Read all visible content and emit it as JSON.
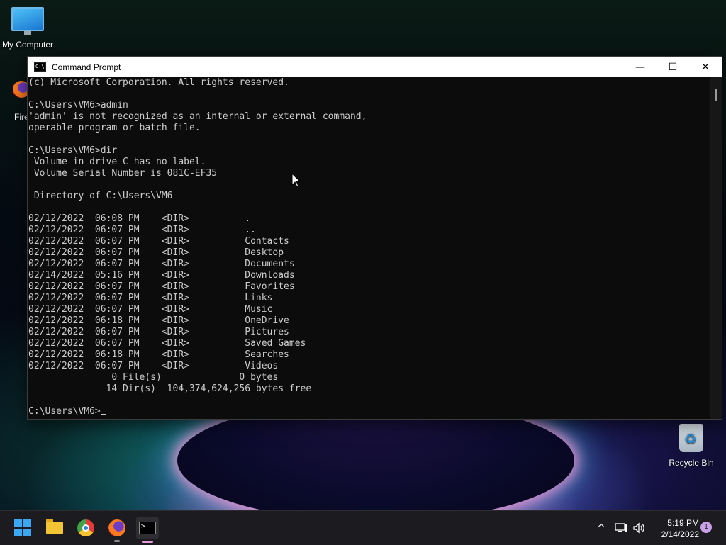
{
  "desktop": {
    "icons": [
      {
        "label": "My Computer",
        "icon": "computer-icon"
      },
      {
        "label": "Fire",
        "icon": "firefox-icon"
      },
      {
        "label": "Recycle Bin",
        "icon": "recycle-bin-icon"
      }
    ]
  },
  "window": {
    "title": "Command Prompt",
    "minimize": "—",
    "maximize": "☐",
    "close": "✕",
    "console_lines": [
      "(c) Microsoft Corporation. All rights reserved.",
      "",
      "C:\\Users\\VM6>admin",
      "'admin' is not recognized as an internal or external command,",
      "operable program or batch file.",
      "",
      "C:\\Users\\VM6>dir",
      " Volume in drive C has no label.",
      " Volume Serial Number is 081C-EF35",
      "",
      " Directory of C:\\Users\\VM6",
      "",
      "02/12/2022  06:08 PM    <DIR>          .",
      "02/12/2022  06:07 PM    <DIR>          ..",
      "02/12/2022  06:07 PM    <DIR>          Contacts",
      "02/12/2022  06:07 PM    <DIR>          Desktop",
      "02/12/2022  06:07 PM    <DIR>          Documents",
      "02/14/2022  05:16 PM    <DIR>          Downloads",
      "02/12/2022  06:07 PM    <DIR>          Favorites",
      "02/12/2022  06:07 PM    <DIR>          Links",
      "02/12/2022  06:07 PM    <DIR>          Music",
      "02/12/2022  06:18 PM    <DIR>          OneDrive",
      "02/12/2022  06:07 PM    <DIR>          Pictures",
      "02/12/2022  06:07 PM    <DIR>          Saved Games",
      "02/12/2022  06:18 PM    <DIR>          Searches",
      "02/12/2022  06:07 PM    <DIR>          Videos",
      "               0 File(s)              0 bytes",
      "              14 Dir(s)  104,374,624,256 bytes free",
      ""
    ],
    "prompt": "C:\\Users\\VM6>"
  },
  "taskbar": {
    "apps": [
      "start-icon",
      "file-explorer-icon",
      "chrome-icon",
      "firefox-icon",
      "command-prompt-icon"
    ],
    "tray": {
      "chevron": "^",
      "time": "5:19 PM",
      "date": "2/14/2022",
      "notifications": "1"
    }
  },
  "colors": {
    "console_bg": "#0c0c0c",
    "console_fg": "#cccccc",
    "taskbar_bg": "#1c1c20",
    "accent": "#3aa8f3"
  }
}
